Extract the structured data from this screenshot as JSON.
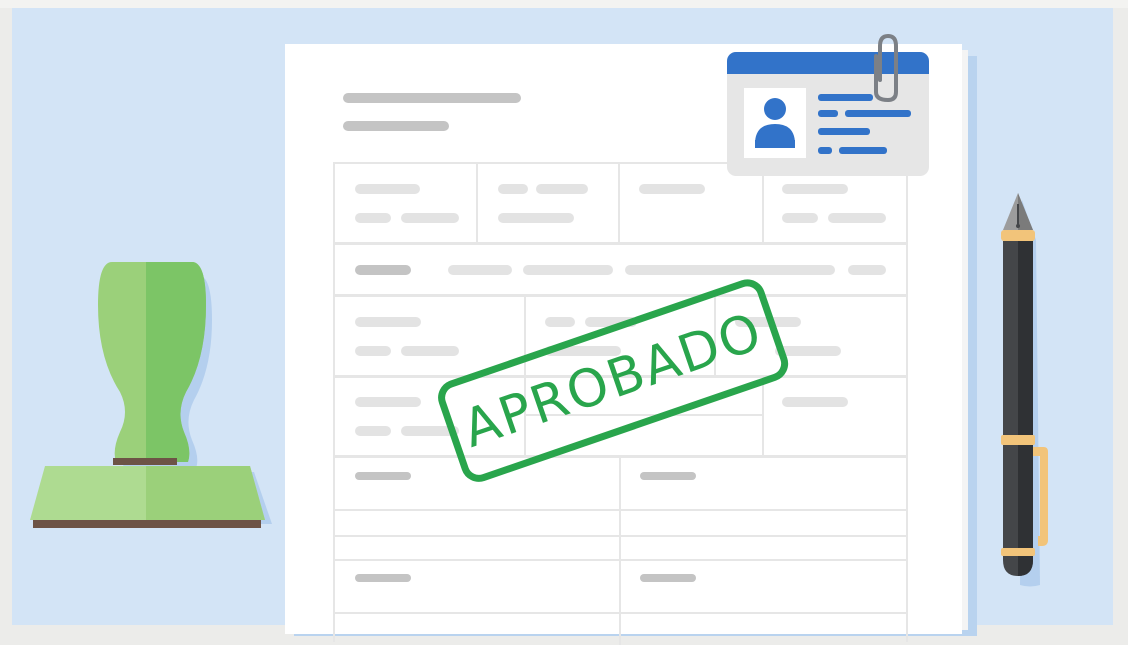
{
  "stamp": {
    "text": "APROBADO",
    "color": "#29a54c"
  },
  "scene": {
    "background_color": "#d3e4f6",
    "paper_color": "#ffffff",
    "id_card_accent": "#3273c9",
    "rubber_stamp_color": "#7cc566",
    "pen_color": "#444649",
    "pen_trim_color": "#f2c47a"
  },
  "icons": {
    "rubber_stamp": "rubber-stamp-icon",
    "fountain_pen": "fountain-pen-icon",
    "id_card": "id-card-icon",
    "paperclip": "paperclip-icon",
    "user_avatar": "user-avatar-icon"
  }
}
